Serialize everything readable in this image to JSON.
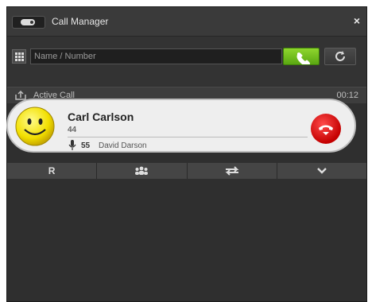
{
  "window": {
    "title": "Call Manager",
    "close": "×"
  },
  "search": {
    "placeholder": "Name / Number"
  },
  "active_call": {
    "label": "Active Call",
    "timer": "00:12",
    "caller_name": "Carl Carlson",
    "caller_number": "44",
    "line_number": "55",
    "line_name": "David Darson"
  },
  "actions": {
    "redial_label": "R"
  },
  "colors": {
    "call_green": "#6cbf1c",
    "hangup_red": "#d20000",
    "avatar_yellow": "#f7e600"
  }
}
